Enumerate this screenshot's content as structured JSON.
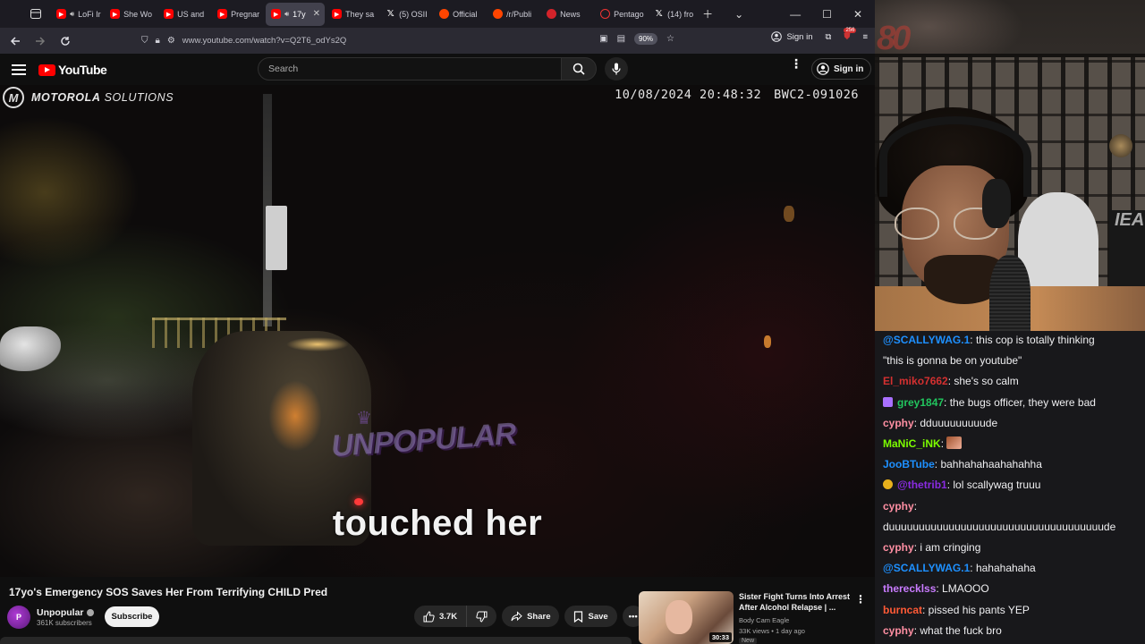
{
  "browser": {
    "tabs": [
      {
        "label": "LoFi Ir",
        "favicon": "youtube-icon",
        "audio": true,
        "active": false
      },
      {
        "label": "She Wo",
        "favicon": "youtube-icon",
        "audio": false,
        "active": false
      },
      {
        "label": "US and",
        "favicon": "youtube-icon",
        "audio": false,
        "active": false
      },
      {
        "label": "Pregnar",
        "favicon": "youtube-icon",
        "audio": false,
        "active": false
      },
      {
        "label": "17y",
        "favicon": "youtube-icon",
        "audio": true,
        "active": true
      },
      {
        "label": "They sa",
        "favicon": "youtube-icon",
        "audio": false,
        "active": false
      },
      {
        "label": "(5) OSII",
        "favicon": "x-icon",
        "audio": false,
        "active": false
      },
      {
        "label": "Official",
        "favicon": "reddit-icon",
        "audio": false,
        "active": false
      },
      {
        "label": "/r/Publi",
        "favicon": "reddit-icon",
        "audio": false,
        "active": false
      },
      {
        "label": "News",
        "favicon": "news-icon",
        "audio": false,
        "active": false
      },
      {
        "label": "Pentago",
        "favicon": "pentagon-icon",
        "audio": false,
        "active": false
      },
      {
        "label": "(14) fro",
        "favicon": "x-icon",
        "audio": false,
        "active": false
      }
    ],
    "url": "www.youtube.com/watch?v=Q2T6_odYs2Q",
    "zoom": "90%",
    "sign_in": "Sign in",
    "ext_badge": "256"
  },
  "youtube": {
    "logo_text": "YouTube",
    "search_placeholder": "Search",
    "sign_in": "Sign in"
  },
  "video": {
    "bwc_brand_bold": "MOTOROLA",
    "bwc_brand_light": "SOLUTIONS",
    "bwc_date": "10/08/2024 20:48:32",
    "bwc_id": "BWC2-091026",
    "watermark": "UNPOPULAR",
    "caption": "touched her",
    "title": "17yo's Emergency SOS Saves Her From Terrifying CHILD Pred",
    "channel": "Unpopular",
    "subscribers": "361K subscribers",
    "subscribe_label": "Subscribe",
    "likes": "3.7K",
    "share_label": "Share",
    "save_label": "Save"
  },
  "recommendation": {
    "title": "Sister Fight Turns Into Arrest After Alcohol Relapse | ...",
    "channel": "Body Cam Eagle",
    "meta": "33K views • 1 day ago",
    "badge": "New",
    "duration": "30:33"
  },
  "webcam": {
    "logo_text": "80",
    "poster_text": "IEA"
  },
  "chat": {
    "messages": [
      {
        "user": "@SCALLYWAG.1",
        "color": "#1e90ff",
        "text": ": this cop is totally thinking",
        "badge": ""
      },
      {
        "user": "",
        "color": "#efeff1",
        "text": "\"this is gonna be on youtube\"",
        "badge": ""
      },
      {
        "user": "El_miko7662",
        "color": "#d43030",
        "text": ": she's so calm",
        "badge": ""
      },
      {
        "user": "grey1847",
        "color": "#22c55e",
        "text": ": the bugs officer, they were bad",
        "badge": "#a970ff"
      },
      {
        "user": "cyphy",
        "color": "#ff8fa3",
        "text": ": dduuuuuuuuude",
        "badge": ""
      },
      {
        "user": "MaNiC_iNK",
        "color": "#7cfc00",
        "text": ": ",
        "badge": "",
        "emote": true
      },
      {
        "user": "JooBTube",
        "color": "#1e90ff",
        "text": ": bahhahahaahahahha",
        "badge": ""
      },
      {
        "user": "@thetrib1",
        "color": "#8a2be2",
        "text": ": lol scallywag truuu",
        "badge": "#e8b11c"
      },
      {
        "user": "cyphy",
        "color": "#ff8fa3",
        "text": ":",
        "badge": ""
      },
      {
        "user": "",
        "color": "#efeff1",
        "text": "duuuuuuuuuuuuuuuuuuuuuuuuuuuuuuuuuuuude",
        "badge": ""
      },
      {
        "user": "cyphy",
        "color": "#ff8fa3",
        "text": ": i am cringing",
        "badge": ""
      },
      {
        "user": "@SCALLYWAG.1",
        "color": "#1e90ff",
        "text": ": hahahahaha",
        "badge": ""
      },
      {
        "user": "therecklss",
        "color": "#c97bff",
        "text": ": LMAOOO",
        "badge": ""
      },
      {
        "user": "burncat",
        "color": "#ff5a36",
        "text": ": pissed his pants YEP",
        "badge": ""
      },
      {
        "user": "cyphy",
        "color": "#ff8fa3",
        "text": ": what the fuck bro",
        "badge": ""
      }
    ]
  }
}
